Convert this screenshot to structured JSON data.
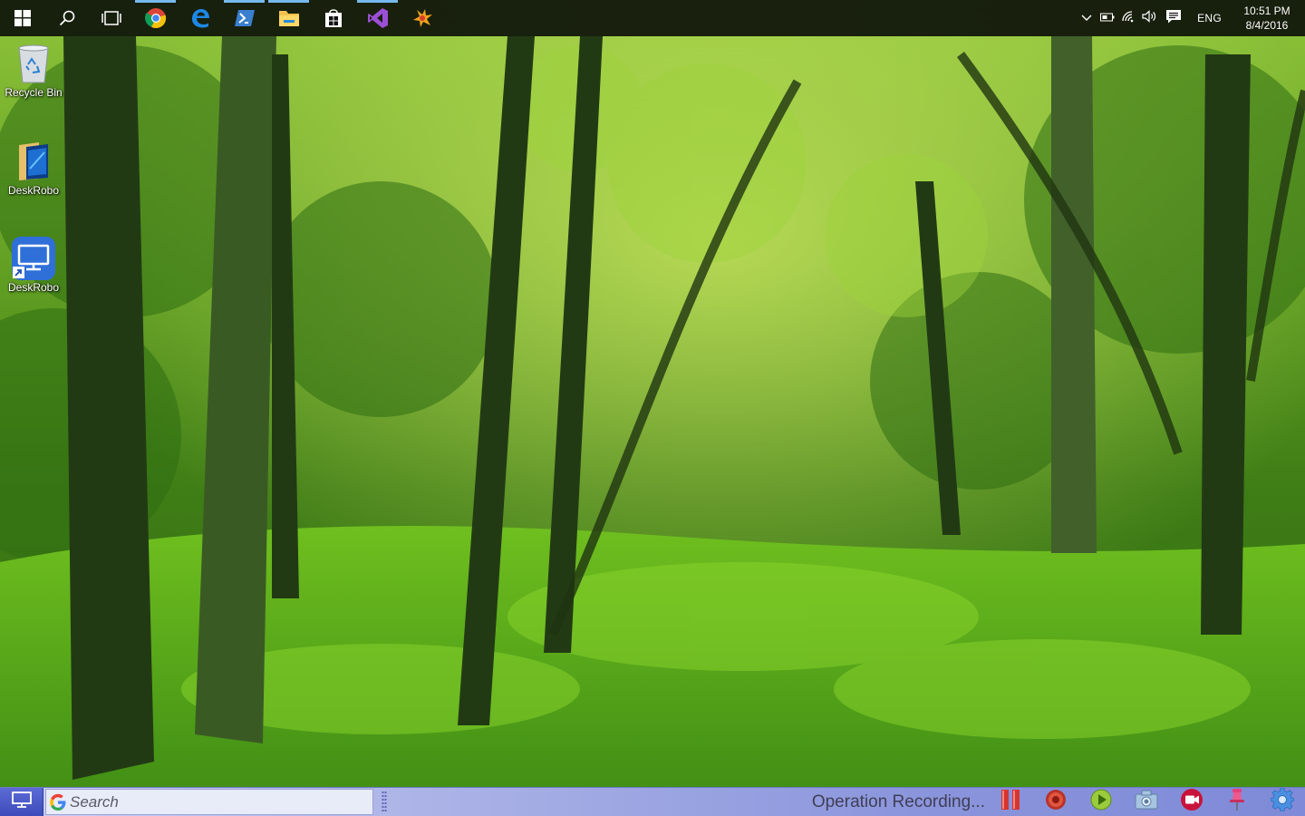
{
  "desktop": {
    "icons": [
      {
        "label": "Recycle Bin",
        "icon": "recycle-bin-icon"
      },
      {
        "label": "DeskRobo",
        "icon": "folder-icon"
      },
      {
        "label": "DeskRobo",
        "icon": "monitor-shortcut-icon"
      }
    ]
  },
  "taskbar": {
    "pinned": [
      {
        "name": "start",
        "icon": "windows-logo-icon"
      },
      {
        "name": "search",
        "icon": "search-icon"
      },
      {
        "name": "task-view",
        "icon": "task-view-icon"
      },
      {
        "name": "chrome",
        "icon": "chrome-icon",
        "active": true
      },
      {
        "name": "edge",
        "icon": "edge-icon"
      },
      {
        "name": "powershell",
        "icon": "powershell-icon",
        "active": true
      },
      {
        "name": "file-explorer",
        "icon": "folder-icon",
        "active": true
      },
      {
        "name": "store",
        "icon": "store-icon"
      },
      {
        "name": "visual-studio",
        "icon": "visual-studio-icon",
        "active": true
      },
      {
        "name": "paint-app",
        "icon": "paint-splash-icon"
      }
    ],
    "tray": {
      "language": "ENG",
      "time": "10:51 PM",
      "date": "8/4/2016"
    }
  },
  "deskrobo_bar": {
    "search_placeholder": "Search",
    "status_text": "Operation Recording...",
    "tools": [
      "pause-icon",
      "record-icon",
      "play-icon",
      "camera-icon",
      "video-record-icon",
      "pin-icon",
      "settings-gear-icon"
    ]
  },
  "colors": {
    "taskbar_bg": "#0e120a",
    "active_indicator": "#76b9ed",
    "bar_gradient_start": "#cdd3f2",
    "bar_gradient_end": "#7f8ad8",
    "status_text": "#3f3f55"
  }
}
